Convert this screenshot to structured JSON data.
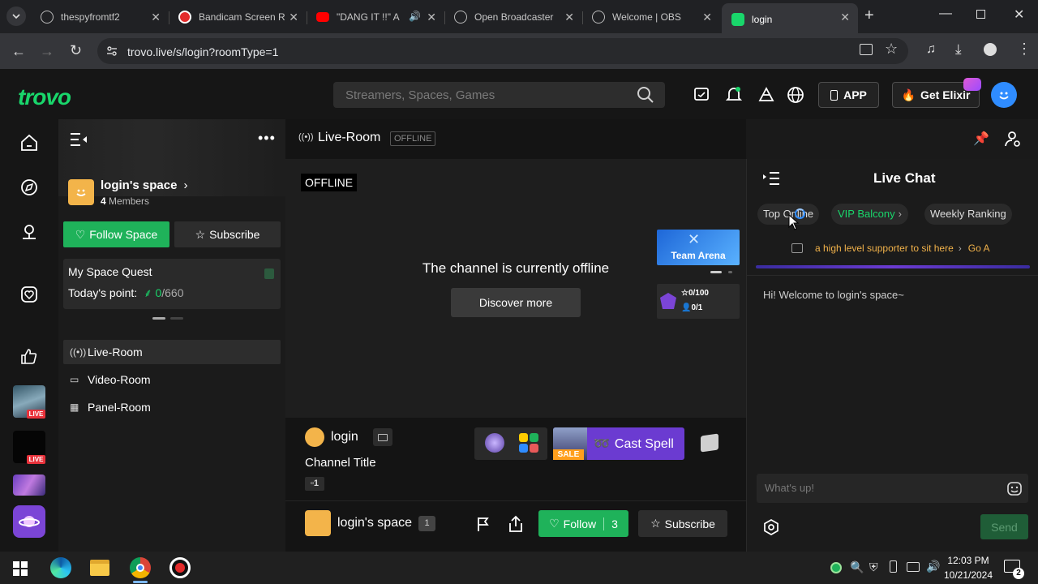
{
  "browser": {
    "tabs": [
      {
        "title": "thespyfromtf2",
        "favicon": "globe-icon",
        "active": false
      },
      {
        "title": "Bandicam Screen R",
        "favicon": "bandicam-icon",
        "active": false
      },
      {
        "title": "\"DANG IT !!\" A",
        "favicon": "youtube-icon",
        "active": false
      },
      {
        "title": "Open Broadcaster",
        "favicon": "globe-icon",
        "active": false
      },
      {
        "title": "Welcome | OBS",
        "favicon": "globe-icon",
        "active": false
      },
      {
        "title": "login",
        "favicon": "trovo-icon",
        "active": true
      }
    ],
    "url": "trovo.live/s/login?roomType=1"
  },
  "header": {
    "logo": "trovo",
    "search_placeholder": "Streamers, Spaces, Games",
    "app_label": "APP",
    "elixir_label": "Get Elixir"
  },
  "sidebar": {
    "space_name": "login's space",
    "members_count": "4",
    "members_label": "Members",
    "follow_label": "Follow Space",
    "subscribe_label": "Subscribe",
    "quest_title": "My Space Quest",
    "quest_points_label": "Today's point:",
    "quest_points_value": "0",
    "quest_points_total": "/660",
    "nav": [
      {
        "label": "Live-Room",
        "icon": "broadcast-icon",
        "active": true
      },
      {
        "label": "Video-Room",
        "icon": "video-icon",
        "active": false
      },
      {
        "label": "Panel-Room",
        "icon": "panel-icon",
        "active": false
      }
    ]
  },
  "room": {
    "title": "Live-Room",
    "status": "OFFLINE",
    "player_badge": "OFFLINE",
    "offline_message": "The channel is currently offline",
    "discover_label": "Discover more",
    "team_arena_label": "Team Arena",
    "stats": {
      "stars": "0/100",
      "people": "0/1"
    }
  },
  "streamer": {
    "name": "login",
    "channel_title": "Channel Title",
    "level": "1",
    "cast_spell_label": "Cast Spell",
    "sale_label": "SALE"
  },
  "footer": {
    "space_name": "login's space",
    "space_badge": "1",
    "follow_label": "Follow",
    "follow_count": "3",
    "subscribe_label": "Subscribe"
  },
  "chat": {
    "title": "Live Chat",
    "tabs": [
      "Top Online",
      "VIP Balcony",
      "Weekly Ranking"
    ],
    "ticker": "a high level supporter to sit here",
    "ticker_link": "Go A",
    "welcome": "Hi! Welcome to login's space~",
    "input_placeholder": "What's up!",
    "send_label": "Send"
  },
  "taskbar": {
    "time": "12:03 PM",
    "date": "10/21/2024",
    "notif_count": "2"
  },
  "colors": {
    "accent_green": "#19d66b",
    "button_green": "#1fb25a",
    "cast_purple": "#6b3bd1"
  }
}
